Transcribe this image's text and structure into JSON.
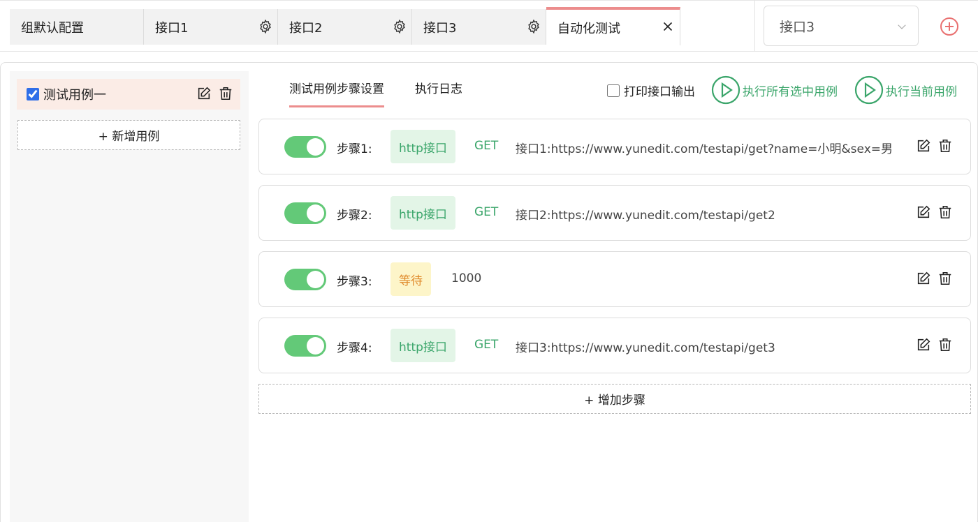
{
  "top_tabs": [
    {
      "label": "组默认配置"
    },
    {
      "label": "接口1"
    },
    {
      "label": "接口2"
    },
    {
      "label": "接口3"
    },
    {
      "label": "自动化测试"
    }
  ],
  "env_select": {
    "value": "接口3"
  },
  "sidebar": {
    "cases": [
      {
        "label": "测试用例一",
        "checked": true
      }
    ],
    "add_case_label": "+ 新增用例"
  },
  "content_tabs": [
    {
      "label": "测试用例步骤设置",
      "active": true
    },
    {
      "label": "执行日志",
      "active": false
    }
  ],
  "print_option": {
    "label": "打印接口输出",
    "checked": false
  },
  "run_selected_label": "执行所有选中用例",
  "run_current_label": "执行当前用例",
  "steps": [
    {
      "label": "步骤1:",
      "tag": "http接口",
      "method": "GET",
      "detail": "接口1:https://www.yunedit.com/testapi/get?name=小明&sex=男",
      "enabled": true
    },
    {
      "label": "步骤2:",
      "tag": "http接口",
      "method": "GET",
      "detail": "接口2:https://www.yunedit.com/testapi/get2",
      "enabled": true
    },
    {
      "label": "步骤3:",
      "tag": "等待",
      "detail": "1000",
      "enabled": true
    },
    {
      "label": "步骤4:",
      "tag": "http接口",
      "method": "GET",
      "detail": "接口3:https://www.yunedit.com/testapi/get3",
      "enabled": true
    }
  ],
  "add_step_label": "+ 增加步骤",
  "colors": {
    "accent_tab": "#ec8d8d",
    "green": "#3aa56a",
    "toggle_on": "#63c978",
    "wait_tag": "#e08a2b"
  }
}
